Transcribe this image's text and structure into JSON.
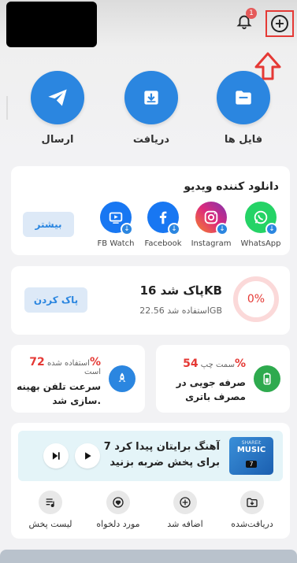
{
  "header": {
    "notification_count": "1"
  },
  "actions": [
    {
      "label": "فایل ها",
      "icon": "folder-icon"
    },
    {
      "label": "دریافت",
      "icon": "receive-icon"
    },
    {
      "label": "ارسال",
      "icon": "send-icon"
    }
  ],
  "video_downloader": {
    "title": "دانلود کننده ویدیو",
    "more_label": "بیشتر",
    "apps": [
      {
        "name": "WhatsApp",
        "icon": "whatsapp-icon",
        "color": "#25d366"
      },
      {
        "name": "Instagram",
        "icon": "instagram-icon",
        "color": "#dd2a7b"
      },
      {
        "name": "Facebook",
        "icon": "facebook-icon",
        "color": "#1877f2"
      },
      {
        "name": "FB Watch",
        "icon": "fb-watch-icon",
        "color": "#1877f2"
      }
    ]
  },
  "storage_clean": {
    "percent": "0%",
    "cleaned_text": "پاک شد 16KB",
    "used_text": "استفاده شد 22.56GB",
    "clean_label": "پاک کردن"
  },
  "battery": {
    "percent": "54%",
    "percent_suffix": "سمت چپ",
    "desc_line1": "صرفه جویی در",
    "desc_line2": "مصرف باتری"
  },
  "boost": {
    "percent": "72%",
    "percent_suffix": "استفاده شده",
    "percent_suffix2": "است",
    "desc_line1": "سرعت تلفن بهینه",
    "desc_line2": "سازی شد."
  },
  "music": {
    "thumb_brand": "SHAREit",
    "thumb_title": "MUSIC",
    "thumb_num": "7",
    "line1": "7 آهنگ برایتان پیدا کرد",
    "line2": "برای پخش ضربه بزنید"
  },
  "music_tabs": [
    {
      "label": "دریافت‌شده",
      "icon": "downloaded-icon"
    },
    {
      "label": "اضافه شد",
      "icon": "add-icon"
    },
    {
      "label": "مورد دلخواه",
      "icon": "favorite-icon"
    },
    {
      "label": "لیست پخش",
      "icon": "playlist-icon"
    }
  ],
  "colors": {
    "accent": "#2b86e0",
    "danger": "#e53935",
    "battery_green": "#2eaa4e"
  }
}
